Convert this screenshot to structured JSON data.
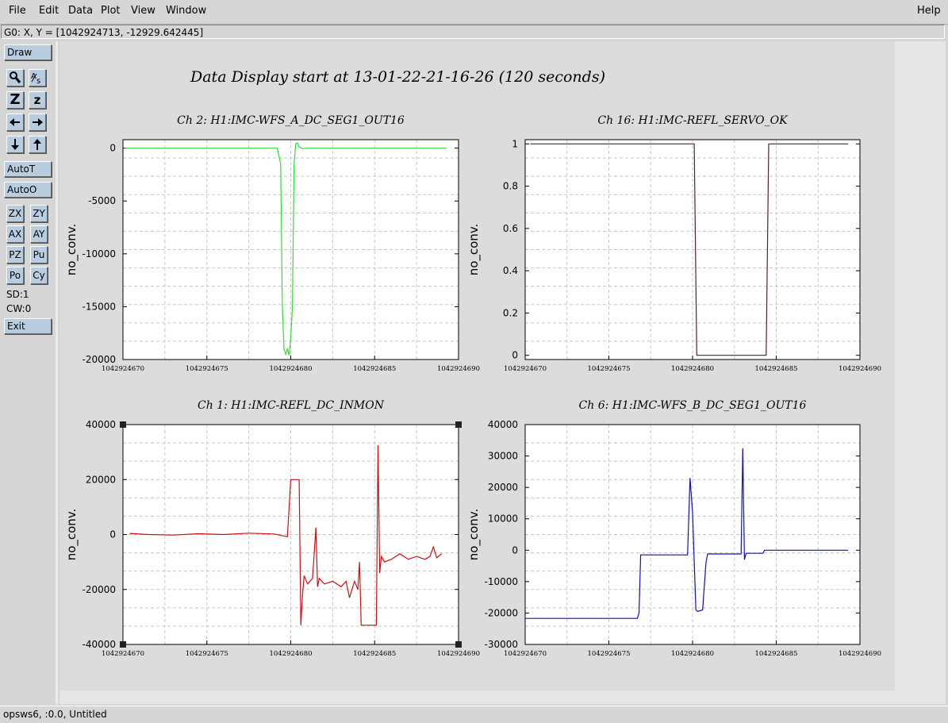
{
  "menu": {
    "file": "File",
    "edit": "Edit",
    "data": "Data",
    "plot": "Plot",
    "view": "View",
    "window": "Window",
    "help": "Help"
  },
  "coord_readout": "G0: X, Y = [1042924713, -12929.642445]",
  "toolbar": {
    "draw": "Draw",
    "zoom_z": "Z",
    "zoom_z_small": "z",
    "autot": "AutoT",
    "autoo": "AutoO",
    "zx": "ZX",
    "zy": "ZY",
    "ax": "AX",
    "ay": "AY",
    "pz": "PZ",
    "pu": "Pu",
    "po": "Po",
    "cy": "Cy",
    "sd": "SD:1",
    "cw": "CW:0",
    "exit": "Exit"
  },
  "status": "opsws6, :0.0, Untitled",
  "main_title": "Data Display start at 13-01-22-21-16-26 (120 seconds)",
  "colors": {
    "ch2": "#33dd33",
    "ch16": "#5a1a3a",
    "ch1": "#cc1111",
    "ch6": "#1111bb",
    "button": "#b9cde0"
  },
  "chart_data": [
    {
      "type": "line",
      "title": "Ch 2: H1:IMC-WFS_A_DC_SEG1_OUT16",
      "ylabel": "no_conv.",
      "xlim": [
        1042924670,
        1042924690
      ],
      "ylim": [
        -20000,
        800
      ],
      "xticks": [
        1042924670,
        1042924675,
        1042924680,
        1042924685,
        1042924690
      ],
      "xtick_labels": [
        "1042924670",
        "1042924675",
        "1042924680",
        "1042924685",
        "1042924690"
      ],
      "yticks": [
        0,
        -5000,
        -10000,
        -15000,
        -20000
      ],
      "ytick_labels": [
        "0",
        "-5000",
        "-10000",
        "-15000",
        "-20000"
      ],
      "series": [
        {
          "color": "#33dd33",
          "x": [
            1042924670.1,
            1042924679.2,
            1042924679.4,
            1042924679.5,
            1042924679.6,
            1042924679.7,
            1042924679.8,
            1042924679.9,
            1042924680.0,
            1042924680.1,
            1042924680.2,
            1042924680.3,
            1042924680.4,
            1042924680.5,
            1042924680.7,
            1042924681.0,
            1042924689.3
          ],
          "y": [
            0,
            0,
            -1500,
            -15000,
            -19000,
            -19500,
            -19000,
            -19600,
            -18000,
            -15000,
            -1500,
            400,
            500,
            100,
            -50,
            0,
            0
          ]
        }
      ]
    },
    {
      "type": "line",
      "title": "Ch 16: H1:IMC-REFL_SERVO_OK",
      "ylabel": "no_conv.",
      "xlim": [
        1042924670,
        1042924690
      ],
      "ylim": [
        -0.02,
        1.02
      ],
      "xticks": [
        1042924670,
        1042924675,
        1042924680,
        1042924685,
        1042924690
      ],
      "xtick_labels": [
        "1042924670",
        "1042924675",
        "1042924680",
        "1042924685",
        "1042924690"
      ],
      "yticks": [
        0,
        0.2,
        0.4,
        0.6,
        0.8,
        1
      ],
      "ytick_labels": [
        "0",
        "0.2",
        "0.4",
        "0.6",
        "0.8",
        "1"
      ],
      "series": [
        {
          "color": "#5a1a3a",
          "x": [
            1042924670.3,
            1042924680.1,
            1042924680.25,
            1042924684.4,
            1042924684.55,
            1042924689.3
          ],
          "y": [
            1,
            1,
            0,
            0,
            1,
            1
          ]
        }
      ]
    },
    {
      "type": "line",
      "title": "Ch 1: H1:IMC-REFL_DC_INMON",
      "ylabel": "no_conv.",
      "xlim": [
        1042924670,
        1042924690
      ],
      "ylim": [
        -40000,
        40000
      ],
      "xticks": [
        1042924670,
        1042924675,
        1042924680,
        1042924685,
        1042924690
      ],
      "xtick_labels": [
        "1042924670",
        "1042924675",
        "1042924680",
        "1042924685",
        "1042924690"
      ],
      "yticks": [
        40000,
        20000,
        0,
        -20000,
        -40000
      ],
      "ytick_labels": [
        "40000",
        "20000",
        "0",
        "-20000",
        "-40000"
      ],
      "series": [
        {
          "color": "#cc1111",
          "x": [
            1042924670.4,
            1042924671.5,
            1042924673,
            1042924674.5,
            1042924676,
            1042924677.5,
            1042924679,
            1042924679.8,
            1042924680.0,
            1042924680.1,
            1042924680.5,
            1042924680.6,
            1042924680.7,
            1042924680.8,
            1042924681.0,
            1042924681.3,
            1042924681.5,
            1042924681.6,
            1042924681.7,
            1042924682.0,
            1042924682.5,
            1042924683.0,
            1042924683.3,
            1042924683.5,
            1042924683.8,
            1042924684.0,
            1042924684.1,
            1042924684.2,
            1042924684.3,
            1042924684.5,
            1042924685.1,
            1042924685.2,
            1042924685.3,
            1042924685.4,
            1042924685.6,
            1042924686.0,
            1042924686.5,
            1042924687.0,
            1042924687.5,
            1042924688.0,
            1042924688.3,
            1042924688.5,
            1042924688.7,
            1042924689.0
          ],
          "y": [
            400,
            0,
            -200,
            300,
            0,
            500,
            200,
            -800,
            20000,
            20000,
            20000,
            -33000,
            -22000,
            -15000,
            -18000,
            -16000,
            2500,
            -19000,
            -16000,
            -18000,
            -17000,
            -19000,
            -17000,
            -23000,
            -17000,
            -20000,
            -10000,
            -33000,
            -33000,
            -33000,
            -33000,
            32500,
            -14000,
            -8000,
            -10000,
            -9000,
            -7000,
            -9000,
            -8000,
            -9000,
            -8000,
            -4500,
            -8500,
            -7000
          ]
        }
      ]
    },
    {
      "type": "line",
      "title": "Ch 6: H1:IMC-WFS_B_DC_SEG1_OUT16",
      "ylabel": "no_conv.",
      "xlim": [
        1042924670,
        1042924690
      ],
      "ylim": [
        -30000,
        40000
      ],
      "xticks": [
        1042924670,
        1042924675,
        1042924680,
        1042924685,
        1042924690
      ],
      "xtick_labels": [
        "1042924670",
        "1042924675",
        "1042924680",
        "1042924685",
        "1042924690"
      ],
      "yticks": [
        40000,
        30000,
        20000,
        10000,
        0,
        -10000,
        -20000,
        -30000
      ],
      "ytick_labels": [
        "40000",
        "30000",
        "20000",
        "10000",
        "0",
        "-10000",
        "-20000",
        "-30000"
      ],
      "series": [
        {
          "color": "#1111bb",
          "x": [
            1042924670,
            1042924676.7,
            1042924676.8,
            1042924676.9,
            1042924677.0,
            1042924679.7,
            1042924679.85,
            1042924680.0,
            1042924680.2,
            1042924680.3,
            1042924680.6,
            1042924680.8,
            1042924680.9,
            1042924681.5,
            1042924682.9,
            1042924683.0,
            1042924683.1,
            1042924683.2,
            1042924683.3,
            1042924684.2,
            1042924684.3,
            1042924689.3
          ],
          "y": [
            -21700,
            -21700,
            -20000,
            -1500,
            -1500,
            -1500,
            23000,
            12000,
            -19000,
            -19500,
            -19000,
            -4000,
            -1200,
            -1200,
            -1200,
            32500,
            -3000,
            -1000,
            -1000,
            -1000,
            0,
            0
          ]
        }
      ]
    }
  ]
}
